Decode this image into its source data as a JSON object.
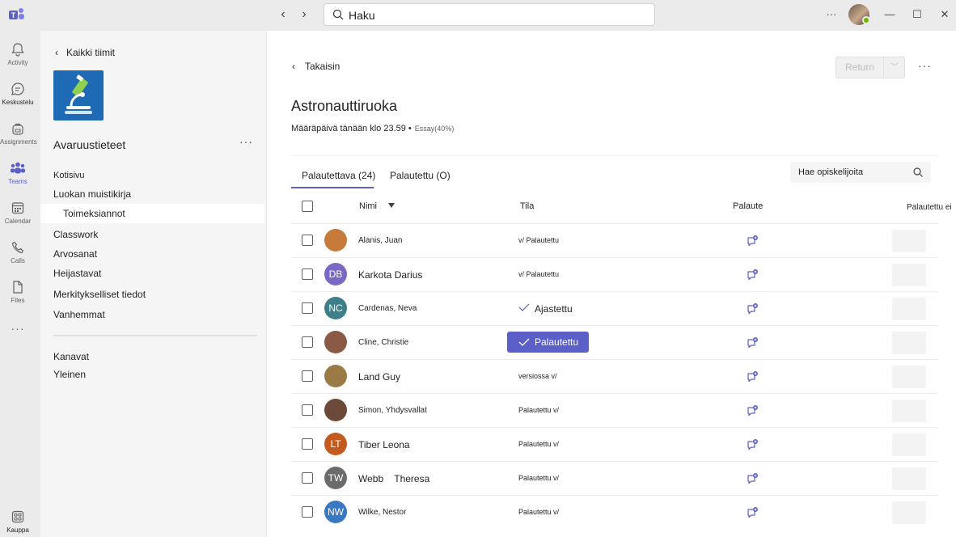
{
  "colors": {
    "accent": "#5b5fc7",
    "rail_bg": "#ebebeb",
    "pane_bg": "#f5f5f5",
    "team_logo_bg": "#1f6ab4"
  },
  "titlebar": {
    "search_placeholder": "Haku",
    "more": "···"
  },
  "rail": {
    "items": [
      {
        "label": "Activity",
        "icon": "bell-icon"
      },
      {
        "label": "Keskustelu",
        "icon": "chat-icon"
      },
      {
        "label": "Assignments",
        "icon": "backpack-icon"
      },
      {
        "label": "Teams",
        "icon": "teams-icon"
      },
      {
        "label": "Calendar",
        "icon": "calendar-icon"
      },
      {
        "label": "Calls",
        "icon": "phone-icon"
      },
      {
        "label": "Files",
        "icon": "file-icon"
      },
      {
        "label": "Kauppa",
        "icon": "apps-icon"
      }
    ],
    "more": "···"
  },
  "team_pane": {
    "back_label": "Kaikki tiimit",
    "team_name": "Avaruustieteet",
    "more": "···",
    "channels": [
      "Kotisivu",
      "Luokan muistikirja",
      "Toimeksiannot",
      "Classwork",
      "Arvosanat",
      "Heijastavat",
      "Merkitykselliset tiedot",
      "Vanhemmat"
    ],
    "sections": [
      "Kanavat",
      "Yleinen"
    ]
  },
  "main": {
    "back_label": "Takaisin",
    "return_label": "Return",
    "more": "···",
    "title": "Astronauttiruoka",
    "due": "Määräpäivä tänään klo 23.59 •",
    "tag": "Essay(40%)",
    "tabs": [
      "Palautettava (24)",
      "Palautettu (O)"
    ],
    "search_placeholder": "Hae opiskelijoita",
    "columns": {
      "name": "Nimi",
      "status": "Tila",
      "feedback": "Palaute",
      "returned": "Palautettu ei"
    }
  },
  "students": [
    {
      "name": "Alanis, Juan",
      "initials": "",
      "avatar_color": "#c77b3a",
      "status": "v/ Palautettu"
    },
    {
      "name": "Karkota Darius",
      "initials": "DB",
      "avatar_color": "#7b68c4",
      "status": "v/ Palautettu"
    },
    {
      "name": "Cardenas, Neva",
      "initials": "NC",
      "avatar_color": "#3f7f8a",
      "status": "Ajastettu"
    },
    {
      "name": "Cline, Christie",
      "initials": "",
      "avatar_color": "#8a5a44",
      "status": "Palautettu"
    },
    {
      "name": "Land Guy",
      "initials": "",
      "avatar_color": "#9a7b45",
      "status": "versiossa v/"
    },
    {
      "name": "Simon, Yhdysvallat",
      "initials": "",
      "avatar_color": "#6b4a3a",
      "status": "Palautettu v/"
    },
    {
      "name": "Tiber Leona",
      "initials": "LT",
      "avatar_color": "#c45a1e",
      "status": "Palautettu v/"
    },
    {
      "name": "Webb    Theresa",
      "initials": "TW",
      "avatar_color": "#6b6b6b",
      "status": "Palautettu v/"
    },
    {
      "name": "Wilke, Nestor",
      "initials": "NW",
      "avatar_color": "#3b78c4",
      "status": "Palautettu v/"
    }
  ]
}
